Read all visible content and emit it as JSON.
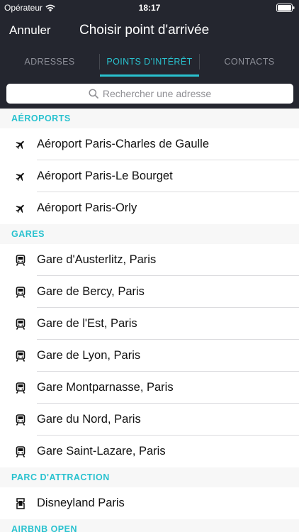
{
  "status_bar": {
    "carrier": "Opérateur",
    "time": "18:17"
  },
  "nav": {
    "cancel_label": "Annuler",
    "title": "Choisir point d'arrivée"
  },
  "tabs": [
    {
      "label": "ADRESSES"
    },
    {
      "label": "POINTS D'INTÉRÊT"
    },
    {
      "label": "CONTACTS"
    }
  ],
  "search": {
    "placeholder": "Rechercher une adresse"
  },
  "sections": [
    {
      "title": "AÉROPORTS",
      "icon": "airplane-icon",
      "items": [
        "Aéroport Paris-Charles de Gaulle",
        "Aéroport Paris-Le Bourget",
        "Aéroport Paris-Orly"
      ]
    },
    {
      "title": "GARES",
      "icon": "train-icon",
      "items": [
        "Gare d'Austerlitz, Paris",
        "Gare de Bercy, Paris",
        "Gare de l'Est, Paris",
        "Gare de Lyon, Paris",
        "Gare Montparnasse, Paris",
        "Gare du Nord, Paris",
        "Gare Saint-Lazare, Paris"
      ]
    },
    {
      "title": "PARC D'ATTRACTION",
      "icon": "ticket-icon",
      "items": [
        "Disneyland Paris"
      ]
    },
    {
      "title": "AIRBNB OPEN",
      "icon": "",
      "items": []
    }
  ],
  "colors": {
    "accent": "#29c2cf",
    "header_bg": "#24262f"
  }
}
